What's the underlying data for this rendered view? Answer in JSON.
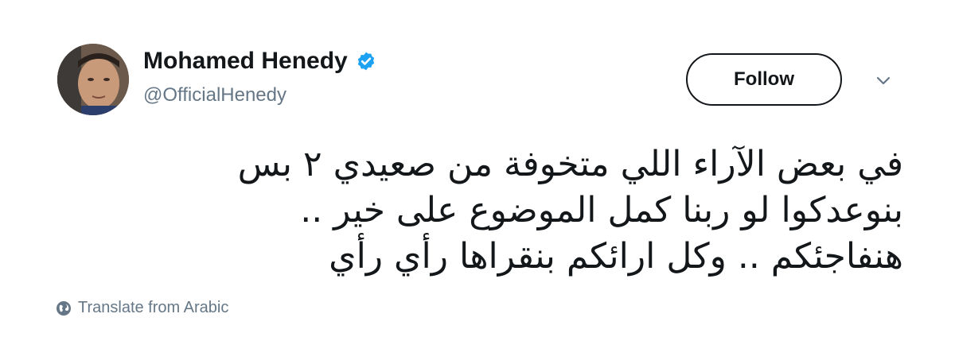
{
  "user": {
    "display_name": "Mohamed Henedy",
    "handle": "@OfficialHenedy",
    "verified": true
  },
  "actions": {
    "follow_label": "Follow"
  },
  "tweet": {
    "text": "في بعض الآراء اللي متخوفة من صعيدي ٢ بس بنوعدكوا لو ربنا كمل الموضوع على خير .. هنفاجئكم .. وكل ارائكم بنقراها رأي رأي"
  },
  "translate": {
    "label": "Translate from Arabic"
  },
  "colors": {
    "verified_blue": "#1da1f2",
    "text_primary": "#14171a",
    "text_secondary": "#657786"
  },
  "icons": {
    "verified": "verified-badge-icon",
    "caret": "chevron-down-icon",
    "globe": "globe-icon"
  }
}
